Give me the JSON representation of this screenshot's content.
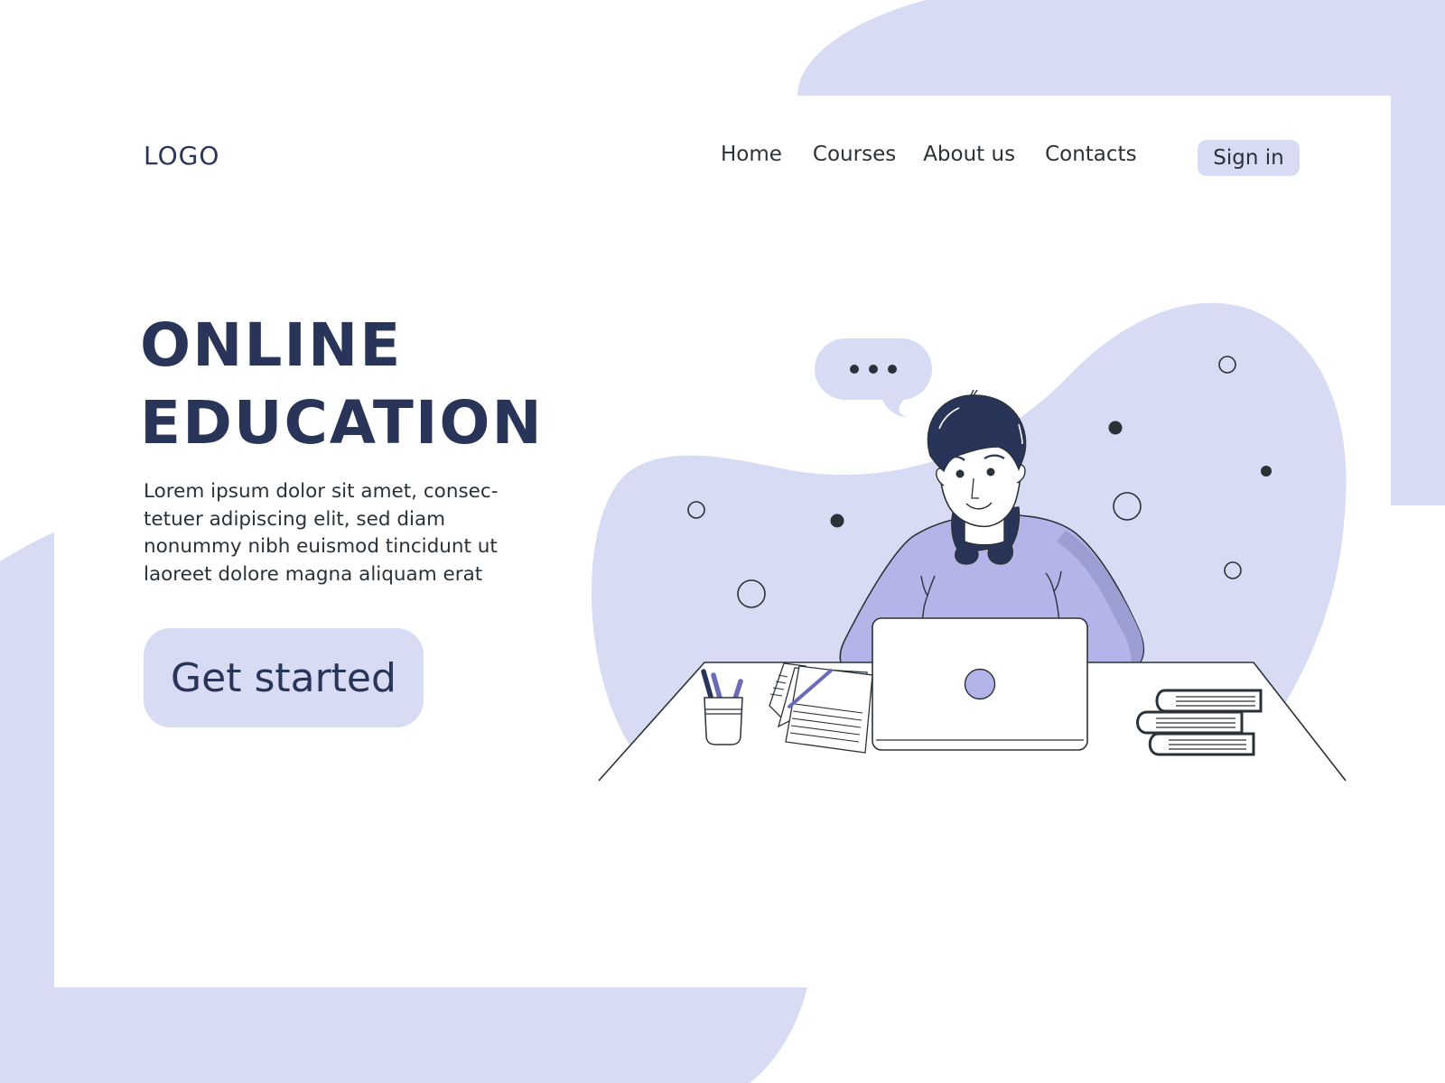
{
  "header": {
    "logo": "LOGO",
    "nav": [
      {
        "label": "Home"
      },
      {
        "label": "Courses"
      },
      {
        "label": "About us"
      },
      {
        "label": "Contacts"
      }
    ],
    "signin_label": "Sign in"
  },
  "hero": {
    "title_line1": "ONLINE",
    "title_line2": "EDUCATION",
    "description": "Lorem ipsum dolor sit amet, consec- tetuer adipiscing elit, sed diam nonummy nibh euismod tincidunt ut laoreet dolore magna aliquam erat",
    "description_lines": [
      "Lorem ipsum dolor sit amet, consec-",
      "tetuer adipiscing elit, sed diam",
      "nonummy nibh euismod tincidunt ut",
      "laoreet dolore magna aliquam erat"
    ],
    "cta_label": "Get started"
  },
  "illustration": {
    "subject": "student studying at a laptop",
    "speech_bubble": "typing-indicator",
    "items": [
      "pencil-cup",
      "papers-with-pen",
      "laptop",
      "stacked-books"
    ]
  },
  "colors": {
    "accent_light": "#d8dbf4",
    "accent_mid": "#b3b5e8",
    "accent_shadow": "#9a9ed2",
    "navy": "#283559",
    "ink": "#2a3238",
    "pen_purple": "#6a6cb8"
  }
}
